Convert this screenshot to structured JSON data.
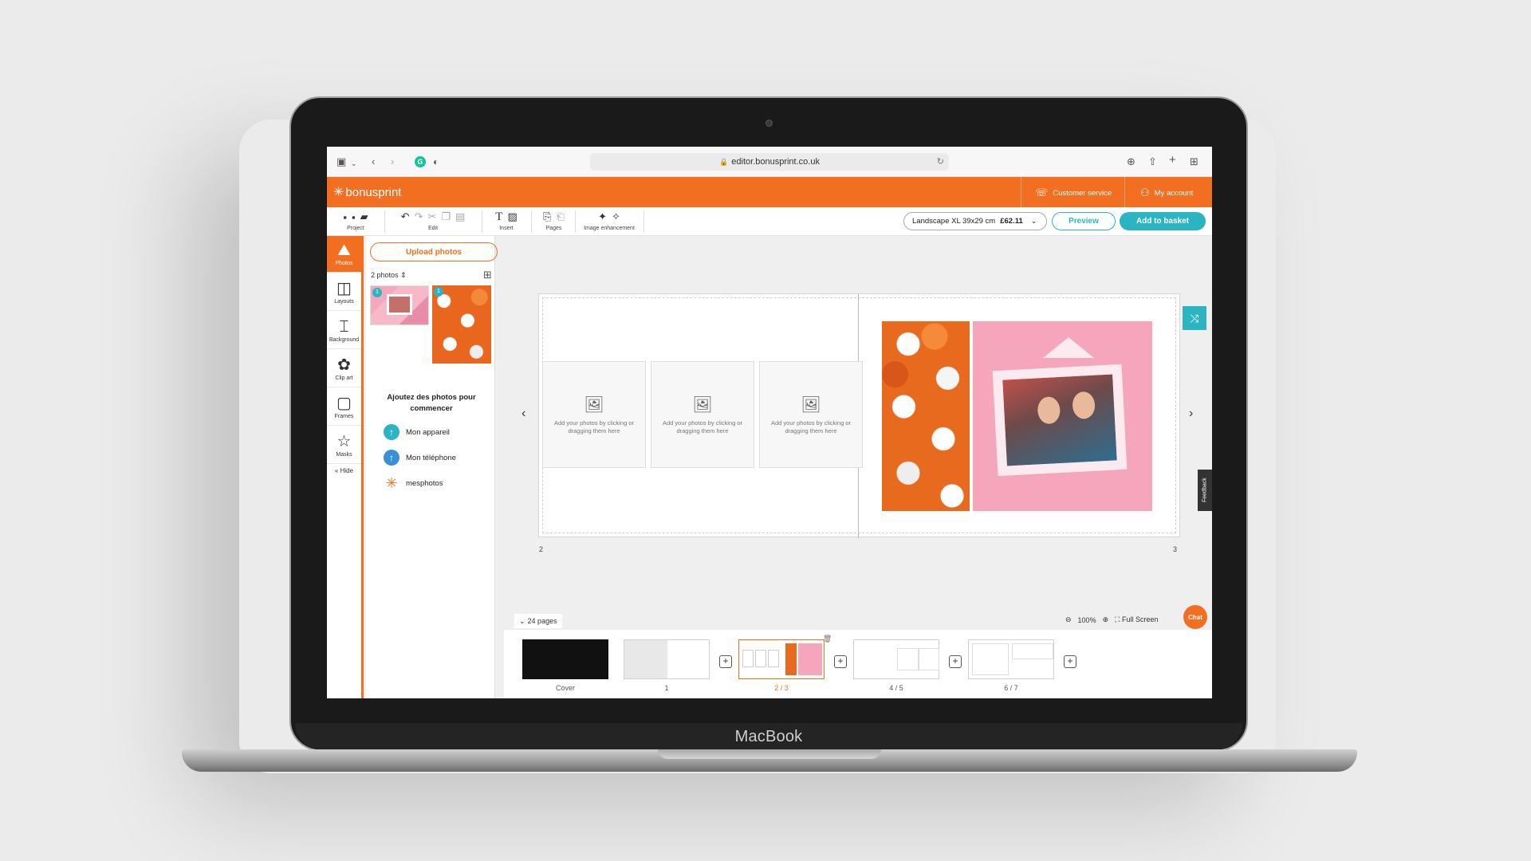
{
  "device": {
    "brand_label": "MacBook"
  },
  "browser": {
    "url": "editor.bonusprint.co.uk",
    "icons": [
      "sidebar-icon",
      "chevron-down-icon",
      "back-icon",
      "forward-icon",
      "grammarly-icon",
      "shield-icon",
      "download-icon",
      "share-icon",
      "new-tab-icon",
      "tab-overview-icon"
    ]
  },
  "header": {
    "logo": "bonusprint",
    "customer_service": "Customer service",
    "my_account": "My account",
    "accent_color": "#f26f21"
  },
  "toolbar": {
    "project_label": "Project",
    "edit_label": "Edit",
    "insert_label": "Insert",
    "pages_label": "Pages",
    "image_enhancement_label": "Image enhancement",
    "format_name": "Landscape XL 39x29 cm",
    "format_price": "£62.11",
    "preview_label": "Preview",
    "add_to_basket_label": "Add to basket",
    "button_color": "#2bb5c2"
  },
  "rail": {
    "items": [
      {
        "label": "Photos",
        "icon": "photos-icon",
        "active": true
      },
      {
        "label": "Layouts",
        "icon": "layouts-icon"
      },
      {
        "label": "Background",
        "icon": "paint-roller-icon"
      },
      {
        "label": "Clip art",
        "icon": "flower-icon"
      },
      {
        "label": "Frames",
        "icon": "frame-icon"
      },
      {
        "label": "Masks",
        "icon": "star-mask-icon"
      }
    ],
    "hide_label": "Hide"
  },
  "panel": {
    "upload_label": "Upload photos",
    "photos_count": "2 photos",
    "thumb_badges": [
      "1",
      "1"
    ],
    "heading": "Ajoutez des photos pour commencer",
    "sources": [
      {
        "label": "Mon appareil",
        "color": "#2bb5c2"
      },
      {
        "label": "Mon téléphone",
        "color": "#3a8fd6"
      },
      {
        "label": "mesphotos",
        "color": "#f26f21"
      }
    ]
  },
  "canvas": {
    "placeholder_text": "Add your photos by clicking or dragging them here",
    "left_page_number": "2",
    "right_page_number": "3",
    "feedback_label": "Feedback"
  },
  "bottom": {
    "page_count": "24 pages",
    "zoom": "100%",
    "full_screen": "Full Screen",
    "chat": "Chat",
    "thumbs": [
      {
        "label": "Cover"
      },
      {
        "label": "1"
      },
      {
        "label": "2 / 3",
        "active": true
      },
      {
        "label": "4 / 5"
      },
      {
        "label": "6 / 7"
      }
    ]
  }
}
